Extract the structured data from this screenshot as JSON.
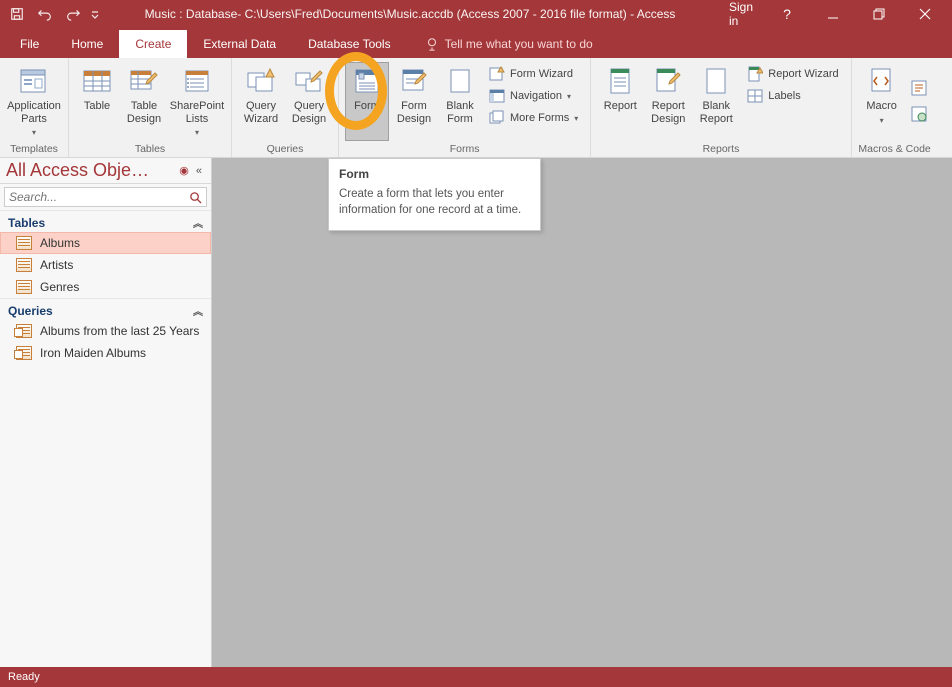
{
  "title_bar": {
    "title": "Music : Database- C:\\Users\\Fred\\Documents\\Music.accdb (Access 2007 - 2016 file format) - Access",
    "sign_in": "Sign in"
  },
  "tabs": {
    "file": "File",
    "home": "Home",
    "create": "Create",
    "external_data": "External Data",
    "database_tools": "Database Tools",
    "tell_me": "Tell me what you want to do"
  },
  "ribbon": {
    "templates": {
      "label": "Templates",
      "application_parts": "Application\nParts"
    },
    "tables": {
      "label": "Tables",
      "table": "Table",
      "table_design": "Table\nDesign",
      "sharepoint_lists": "SharePoint\nLists"
    },
    "queries": {
      "label": "Queries",
      "query_wizard": "Query\nWizard",
      "query_design": "Query\nDesign"
    },
    "forms": {
      "label": "Forms",
      "form": "Form",
      "form_design": "Form\nDesign",
      "blank_form": "Blank\nForm",
      "form_wizard": "Form Wizard",
      "navigation": "Navigation",
      "more_forms": "More Forms"
    },
    "reports": {
      "label": "Reports",
      "report": "Report",
      "report_design": "Report\nDesign",
      "blank_report": "Blank\nReport",
      "report_wizard": "Report Wizard",
      "labels": "Labels"
    },
    "macros": {
      "label": "Macros & Code",
      "macro": "Macro"
    }
  },
  "nav": {
    "title": "All Access Obje…",
    "search_placeholder": "Search...",
    "groups": {
      "tables": {
        "label": "Tables",
        "items": [
          "Albums",
          "Artists",
          "Genres"
        ]
      },
      "queries": {
        "label": "Queries",
        "items": [
          "Albums from the last 25 Years",
          "Iron Maiden Albums"
        ]
      }
    }
  },
  "tooltip": {
    "title": "Form",
    "body": "Create a form that lets you enter information for one record at a time."
  },
  "status": "Ready"
}
